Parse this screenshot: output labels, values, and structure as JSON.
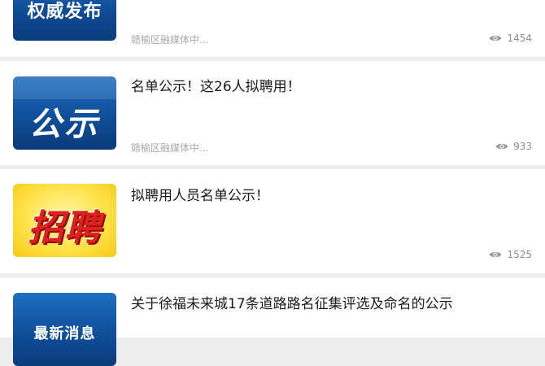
{
  "articles": [
    {
      "title": "",
      "thumb_text": "权威发布",
      "source": "赣榆区融媒体中...",
      "views": "1454"
    },
    {
      "title": "名单公示！这26人拟聘用！",
      "thumb_text": "公示",
      "source": "赣榆区融媒体中...",
      "views": "933"
    },
    {
      "title": "拟聘用人员名单公示！",
      "thumb_text": "招聘",
      "source": "",
      "views": "1525"
    },
    {
      "title": "关于徐福未来城17条道路路名征集评选及命名的公示",
      "thumb_text": "最新消息",
      "source": "",
      "views": ""
    }
  ],
  "colors": {
    "background": "#ececec",
    "card": "#ffffff",
    "thumb_blue": "#1f6fc0",
    "thumb_red_text": "#e0201c",
    "thumb_yellow": "#ffe24a"
  },
  "icons": {
    "views": "eye-icon"
  }
}
